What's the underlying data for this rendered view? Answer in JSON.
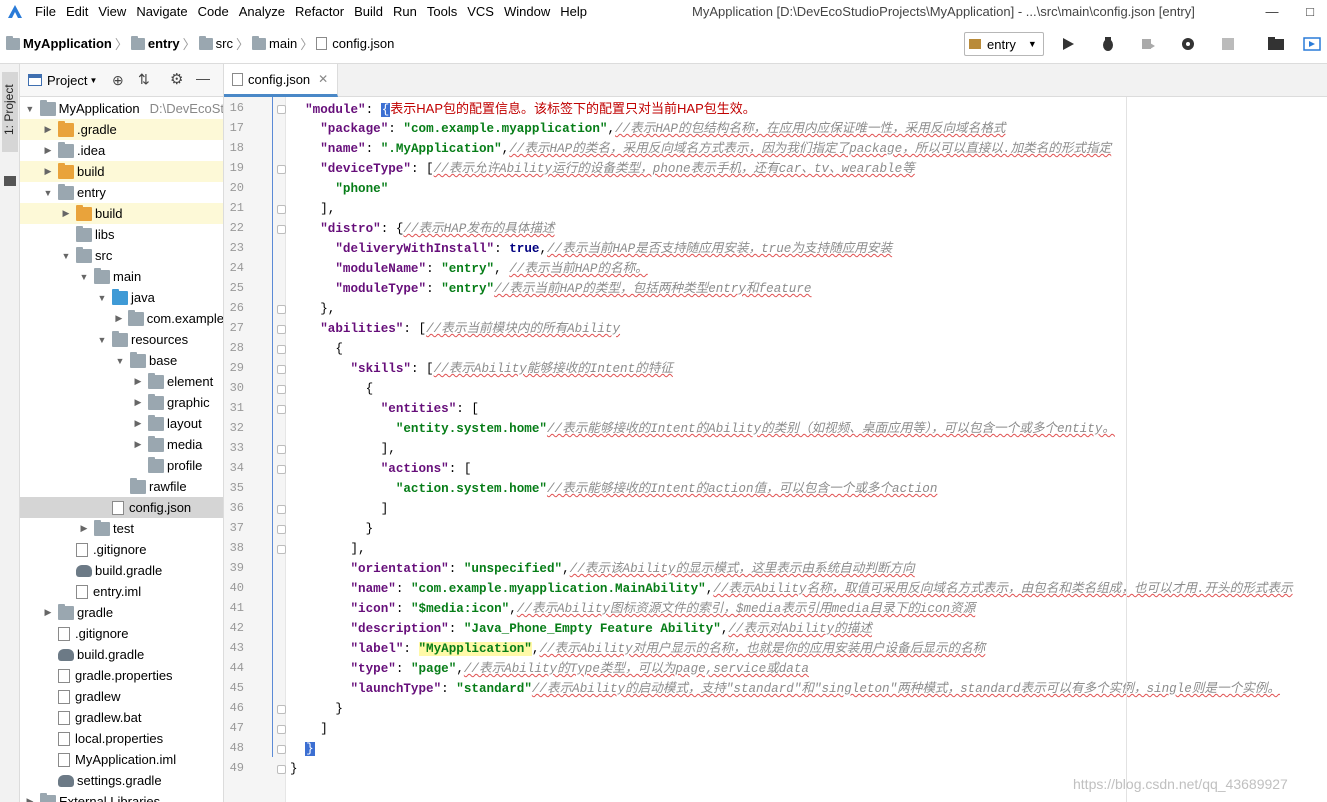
{
  "menu": {
    "items": [
      "File",
      "Edit",
      "View",
      "Navigate",
      "Code",
      "Analyze",
      "Refactor",
      "Build",
      "Run",
      "Tools",
      "VCS",
      "Window",
      "Help"
    ],
    "window_title": "MyApplication [D:\\DevEcoStudioProjects\\MyApplication] - ...\\src\\main\\config.json [entry]"
  },
  "breadcrumb": [
    "MyApplication",
    "entry",
    "src",
    "main",
    "config.json"
  ],
  "run_config": {
    "label": "entry"
  },
  "side_strip": {
    "label": "1: Project"
  },
  "project": {
    "dropdown_label": "Project",
    "tree": [
      {
        "label": "MyApplication",
        "detail": "D:\\DevEcoSt",
        "depth": 0,
        "expanded": true,
        "icon": "folder-gray",
        "hl": false
      },
      {
        "label": ".gradle",
        "depth": 1,
        "expanded": false,
        "icon": "folder-orange",
        "hl": true
      },
      {
        "label": ".idea",
        "depth": 1,
        "expanded": false,
        "icon": "folder-gray",
        "hl": false
      },
      {
        "label": "build",
        "depth": 1,
        "expanded": false,
        "icon": "folder-orange",
        "hl": true
      },
      {
        "label": "entry",
        "depth": 1,
        "expanded": true,
        "icon": "folder-gray",
        "hl": false
      },
      {
        "label": "build",
        "depth": 2,
        "expanded": false,
        "icon": "folder-orange",
        "hl": true
      },
      {
        "label": "libs",
        "depth": 2,
        "expanded": null,
        "icon": "folder-gray",
        "hl": false
      },
      {
        "label": "src",
        "depth": 2,
        "expanded": true,
        "icon": "folder-gray",
        "hl": false
      },
      {
        "label": "main",
        "depth": 3,
        "expanded": true,
        "icon": "folder-gray",
        "hl": false
      },
      {
        "label": "java",
        "depth": 4,
        "expanded": true,
        "icon": "folder-blue",
        "hl": false
      },
      {
        "label": "com.example",
        "depth": 5,
        "expanded": false,
        "icon": "folder-gray",
        "hl": false
      },
      {
        "label": "resources",
        "depth": 4,
        "expanded": true,
        "icon": "folder-gray",
        "hl": false
      },
      {
        "label": "base",
        "depth": 5,
        "expanded": true,
        "icon": "folder-gray",
        "hl": false
      },
      {
        "label": "element",
        "depth": 6,
        "expanded": false,
        "icon": "folder-gray",
        "hl": false
      },
      {
        "label": "graphic",
        "depth": 6,
        "expanded": false,
        "icon": "folder-gray",
        "hl": false
      },
      {
        "label": "layout",
        "depth": 6,
        "expanded": false,
        "icon": "folder-gray",
        "hl": false
      },
      {
        "label": "media",
        "depth": 6,
        "expanded": false,
        "icon": "folder-gray",
        "hl": false
      },
      {
        "label": "profile",
        "depth": 6,
        "expanded": null,
        "icon": "folder-gray",
        "hl": false
      },
      {
        "label": "rawfile",
        "depth": 5,
        "expanded": null,
        "icon": "folder-gray",
        "hl": false
      },
      {
        "label": "config.json",
        "depth": 4,
        "expanded": null,
        "icon": "file",
        "hl": false,
        "selected": true
      },
      {
        "label": "test",
        "depth": 3,
        "expanded": false,
        "icon": "folder-gray",
        "hl": false
      },
      {
        "label": ".gitignore",
        "depth": 2,
        "expanded": null,
        "icon": "file",
        "hl": false
      },
      {
        "label": "build.gradle",
        "depth": 2,
        "expanded": null,
        "icon": "gradle",
        "hl": false
      },
      {
        "label": "entry.iml",
        "depth": 2,
        "expanded": null,
        "icon": "file",
        "hl": false
      },
      {
        "label": "gradle",
        "depth": 1,
        "expanded": false,
        "icon": "folder-gray",
        "hl": false
      },
      {
        "label": ".gitignore",
        "depth": 1,
        "expanded": null,
        "icon": "file",
        "hl": false
      },
      {
        "label": "build.gradle",
        "depth": 1,
        "expanded": null,
        "icon": "gradle",
        "hl": false
      },
      {
        "label": "gradle.properties",
        "depth": 1,
        "expanded": null,
        "icon": "file",
        "hl": false
      },
      {
        "label": "gradlew",
        "depth": 1,
        "expanded": null,
        "icon": "file",
        "hl": false
      },
      {
        "label": "gradlew.bat",
        "depth": 1,
        "expanded": null,
        "icon": "file",
        "hl": false
      },
      {
        "label": "local.properties",
        "depth": 1,
        "expanded": null,
        "icon": "file",
        "hl": false
      },
      {
        "label": "MyApplication.iml",
        "depth": 1,
        "expanded": null,
        "icon": "file",
        "hl": false
      },
      {
        "label": "settings.gradle",
        "depth": 1,
        "expanded": null,
        "icon": "gradle",
        "hl": false
      },
      {
        "label": "External Libraries",
        "depth": 0,
        "expanded": false,
        "icon": "folder-gray",
        "hl": false
      }
    ]
  },
  "editor": {
    "tab_label": "config.json",
    "lines": [
      {
        "n": "16",
        "code": [
          [
            "  ",
            ""
          ],
          [
            "\"module\"",
            "k"
          ],
          [
            ": ",
            ""
          ],
          [
            "{",
            "bm"
          ],
          [
            "表示HAP包的配置信息。该标签下的配置只对当前HAP包生效。",
            "cmnote"
          ]
        ]
      },
      {
        "n": "17",
        "code": [
          [
            "    ",
            ""
          ],
          [
            "\"package\"",
            "k"
          ],
          [
            ": ",
            ""
          ],
          [
            "\"com.example.myapplication\"",
            "s"
          ],
          [
            ",",
            ""
          ],
          [
            "//表示HAP的包结构名称，在应用内应保证唯一性，采用反向域名格式",
            "cm"
          ]
        ]
      },
      {
        "n": "18",
        "code": [
          [
            "    ",
            ""
          ],
          [
            "\"name\"",
            "k"
          ],
          [
            ": ",
            ""
          ],
          [
            "\".MyApplication\"",
            "s"
          ],
          [
            ",",
            ""
          ],
          [
            "//表示HAP的类名，采用反向域名方式表示，因为我们指定了package，所以可以直接以.加类名的形式指定",
            "cm"
          ]
        ]
      },
      {
        "n": "19",
        "code": [
          [
            "    ",
            ""
          ],
          [
            "\"deviceType\"",
            "k"
          ],
          [
            ": [",
            ""
          ],
          [
            "//表示允许Ability运行的设备类型，phone表示手机，还有car、tv、wearable等",
            "cm"
          ]
        ]
      },
      {
        "n": "20",
        "code": [
          [
            "      ",
            ""
          ],
          [
            "\"phone\"",
            "s"
          ]
        ]
      },
      {
        "n": "21",
        "code": [
          [
            "    ],",
            ""
          ]
        ]
      },
      {
        "n": "22",
        "code": [
          [
            "    ",
            ""
          ],
          [
            "\"distro\"",
            "k"
          ],
          [
            ": {",
            ""
          ],
          [
            "//表示HAP发布的具体描述",
            "cm"
          ]
        ]
      },
      {
        "n": "23",
        "code": [
          [
            "      ",
            ""
          ],
          [
            "\"deliveryWithInstall\"",
            "k"
          ],
          [
            ": ",
            ""
          ],
          [
            "true",
            "kw"
          ],
          [
            ",",
            ""
          ],
          [
            "//表示当前HAP是否支持随应用安装，true为支持随应用安装",
            "cm"
          ]
        ]
      },
      {
        "n": "24",
        "code": [
          [
            "      ",
            ""
          ],
          [
            "\"moduleName\"",
            "k"
          ],
          [
            ": ",
            ""
          ],
          [
            "\"entry\"",
            "s"
          ],
          [
            ", ",
            ""
          ],
          [
            "//表示当前HAP的名称。",
            "cm"
          ]
        ]
      },
      {
        "n": "25",
        "code": [
          [
            "      ",
            ""
          ],
          [
            "\"moduleType\"",
            "k"
          ],
          [
            ": ",
            ""
          ],
          [
            "\"entry\"",
            "s"
          ],
          [
            "//表示当前HAP的类型，包括两种类型entry和feature",
            "cm"
          ]
        ]
      },
      {
        "n": "26",
        "code": [
          [
            "    },",
            ""
          ]
        ]
      },
      {
        "n": "27",
        "code": [
          [
            "    ",
            ""
          ],
          [
            "\"abilities\"",
            "k"
          ],
          [
            ": [",
            ""
          ],
          [
            "//表示当前模块内的所有Ability",
            "cm"
          ]
        ]
      },
      {
        "n": "28",
        "code": [
          [
            "      {",
            ""
          ]
        ]
      },
      {
        "n": "29",
        "code": [
          [
            "        ",
            ""
          ],
          [
            "\"skills\"",
            "k"
          ],
          [
            ": [",
            ""
          ],
          [
            "//表示Ability能够接收的Intent的特征",
            "cm"
          ]
        ]
      },
      {
        "n": "30",
        "code": [
          [
            "          {",
            ""
          ]
        ]
      },
      {
        "n": "31",
        "code": [
          [
            "            ",
            ""
          ],
          [
            "\"entities\"",
            "k"
          ],
          [
            ": [",
            ""
          ]
        ]
      },
      {
        "n": "32",
        "code": [
          [
            "              ",
            ""
          ],
          [
            "\"entity.system.home\"",
            "s"
          ],
          [
            "//表示能够接收的Intent的Ability的类别（如视频、桌面应用等），可以包含一个或多个entity。",
            "cm"
          ]
        ]
      },
      {
        "n": "33",
        "code": [
          [
            "            ],",
            ""
          ]
        ]
      },
      {
        "n": "34",
        "code": [
          [
            "            ",
            ""
          ],
          [
            "\"actions\"",
            "k"
          ],
          [
            ": [",
            ""
          ]
        ]
      },
      {
        "n": "35",
        "code": [
          [
            "              ",
            ""
          ],
          [
            "\"action.system.home\"",
            "s"
          ],
          [
            "//表示能够接收的Intent的action值，可以包含一个或多个action",
            "cm"
          ]
        ]
      },
      {
        "n": "36",
        "code": [
          [
            "            ]",
            ""
          ]
        ]
      },
      {
        "n": "37",
        "code": [
          [
            "          }",
            ""
          ]
        ]
      },
      {
        "n": "38",
        "code": [
          [
            "        ],",
            ""
          ]
        ]
      },
      {
        "n": "39",
        "code": [
          [
            "        ",
            ""
          ],
          [
            "\"orientation\"",
            "k"
          ],
          [
            ": ",
            ""
          ],
          [
            "\"unspecified\"",
            "s"
          ],
          [
            ",",
            ""
          ],
          [
            "//表示该Ability的显示模式，这里表示由系统自动判断方向",
            "cm"
          ]
        ]
      },
      {
        "n": "40",
        "code": [
          [
            "        ",
            ""
          ],
          [
            "\"name\"",
            "k"
          ],
          [
            ": ",
            ""
          ],
          [
            "\"com.example.myapplication.MainAbility\"",
            "s"
          ],
          [
            ",",
            ""
          ],
          [
            "//表示Ability名称，取值可采用反向域名方式表示，由包名和类名组成，也可以才用.开头的形式表示",
            "cm"
          ]
        ]
      },
      {
        "n": "41",
        "code": [
          [
            "        ",
            ""
          ],
          [
            "\"icon\"",
            "k"
          ],
          [
            ": ",
            ""
          ],
          [
            "\"$media:icon\"",
            "s"
          ],
          [
            ",",
            ""
          ],
          [
            "//表示Ability图标资源文件的索引，$media表示引用media目录下的icon资源",
            "cm"
          ]
        ]
      },
      {
        "n": "42",
        "code": [
          [
            "        ",
            ""
          ],
          [
            "\"description\"",
            "k"
          ],
          [
            ": ",
            ""
          ],
          [
            "\"Java_Phone_Empty Feature Ability\"",
            "s"
          ],
          [
            ",",
            ""
          ],
          [
            "//表示对Ability的描述",
            "cm"
          ]
        ]
      },
      {
        "n": "43",
        "code": [
          [
            "        ",
            ""
          ],
          [
            "\"label\"",
            "k"
          ],
          [
            ": ",
            ""
          ],
          [
            "\"MyApplication\"",
            "s hlw"
          ],
          [
            ",",
            ""
          ],
          [
            "//表示Ability对用户显示的名称，也就是你的应用安装用户设备后显示的名称",
            "cm"
          ]
        ]
      },
      {
        "n": "44",
        "code": [
          [
            "        ",
            ""
          ],
          [
            "\"type\"",
            "k"
          ],
          [
            ": ",
            ""
          ],
          [
            "\"page\"",
            "s"
          ],
          [
            ",",
            ""
          ],
          [
            "//表示Ability的Type类型，可以为page,service或data",
            "cm"
          ]
        ]
      },
      {
        "n": "45",
        "code": [
          [
            "        ",
            ""
          ],
          [
            "\"launchType\"",
            "k"
          ],
          [
            ": ",
            ""
          ],
          [
            "\"standard\"",
            "s"
          ],
          [
            "//表示Ability的启动模式，支持\"standard\"和\"singleton\"两种模式，standard表示可以有多个实例，single则是一个实例。",
            "cm"
          ]
        ]
      },
      {
        "n": "46",
        "code": [
          [
            "      }",
            ""
          ]
        ]
      },
      {
        "n": "47",
        "code": [
          [
            "    ]",
            ""
          ]
        ]
      },
      {
        "n": "48",
        "code": [
          [
            "  ",
            ""
          ],
          [
            "}",
            "bm"
          ]
        ]
      },
      {
        "n": "49",
        "code": [
          [
            "}",
            ""
          ]
        ]
      }
    ]
  },
  "watermark": "https://blog.csdn.net/qq_43689927",
  "colors": {
    "accent": "#4a88c7",
    "key": "#660e7a",
    "string": "#067d17",
    "comment": "#8c8c8c",
    "note": "#c00000"
  }
}
